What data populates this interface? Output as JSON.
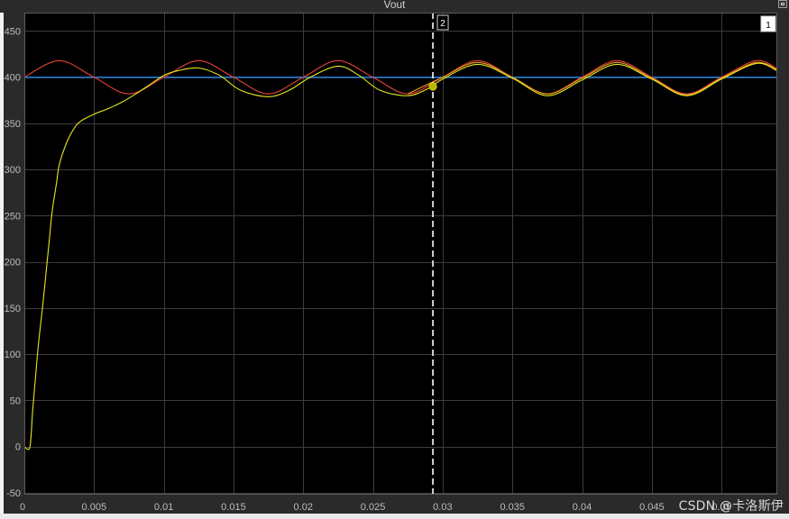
{
  "window": {
    "title": "Vout"
  },
  "watermark": "CSDN @卡洛斯伊",
  "cursors": [
    {
      "label": "1",
      "x": 0.05
    },
    {
      "label": "2",
      "x": 0.0293,
      "marker_y": 390
    }
  ],
  "colors": {
    "background": "#000000",
    "grid": "#3c3c3c",
    "axis_text": "#bdbdbd",
    "reference": "#1e90ff",
    "red": "#e8443a",
    "orange": "#f0a21e",
    "yellow": "#e6e61e",
    "cursor": "#ffffff",
    "marker": "#b8b800"
  },
  "chart_data": {
    "type": "line",
    "title": "Vout",
    "xlabel": "",
    "ylabel": "",
    "xlim": [
      0,
      0.054
    ],
    "ylim": [
      -52,
      470
    ],
    "grid": true,
    "x_ticks": [
      0,
      0.005,
      0.01,
      0.015,
      0.02,
      0.025,
      0.03,
      0.035,
      0.04,
      0.045,
      0.05
    ],
    "x_tick_labels": [
      "0",
      "0.005",
      "0.01",
      "0.015",
      "0.02",
      "0.025",
      "0.03",
      "0.035",
      "0.04",
      "0.045",
      "0.05"
    ],
    "y_ticks": [
      -50,
      0,
      50,
      100,
      150,
      200,
      250,
      300,
      350,
      400,
      450
    ],
    "y_tick_labels": [
      "-50",
      "0",
      "50",
      "100",
      "150",
      "200",
      "250",
      "300",
      "350",
      "400",
      "450"
    ],
    "series": [
      {
        "color": "#1e90ff",
        "x": [
          0,
          0.054
        ],
        "y": [
          400,
          400
        ]
      },
      {
        "color": "#e8443a",
        "x": [
          0,
          0.0025,
          0.005,
          0.0075,
          0.01,
          0.0125,
          0.015,
          0.0175,
          0.02,
          0.0225,
          0.025,
          0.0275,
          0.03,
          0.0325,
          0.035,
          0.0375,
          0.04,
          0.0425,
          0.045,
          0.0475,
          0.05,
          0.0525,
          0.054
        ],
        "y": [
          400,
          418,
          400,
          382,
          400,
          418,
          400,
          382,
          400,
          418,
          400,
          382,
          400,
          418,
          400,
          382,
          400,
          418,
          400,
          382,
          400,
          418,
          409
        ]
      },
      {
        "color": "#f0a21e",
        "x": [
          0.0275,
          0.03,
          0.0325,
          0.035,
          0.0375,
          0.04,
          0.0425,
          0.045,
          0.0475,
          0.05,
          0.0525,
          0.054
        ],
        "y": [
          382,
          400,
          416,
          400,
          382,
          399,
          416,
          399,
          381,
          399,
          416,
          408
        ]
      },
      {
        "color": "#e6e61e",
        "x": [
          0,
          0.0004,
          0.0006,
          0.0008,
          0.001,
          0.0013,
          0.0015,
          0.0018,
          0.002,
          0.0023,
          0.0025,
          0.003,
          0.0035,
          0.004,
          0.005,
          0.006,
          0.007,
          0.008,
          0.009,
          0.01,
          0.011,
          0.0125,
          0.014,
          0.0155,
          0.0175,
          0.019,
          0.0205,
          0.0225,
          0.024,
          0.0255,
          0.0275,
          0.029,
          0.03,
          0.0325,
          0.035,
          0.0375,
          0.04,
          0.0425,
          0.045,
          0.0475,
          0.05,
          0.0525,
          0.054
        ],
        "y": [
          0,
          0,
          40,
          75,
          110,
          150,
          180,
          225,
          255,
          285,
          305,
          328,
          343,
          352,
          360,
          366,
          373,
          382,
          392,
          402,
          407,
          410,
          402,
          386,
          379,
          386,
          400,
          412,
          402,
          386,
          380,
          388,
          398,
          414,
          399,
          380,
          397,
          414,
          398,
          380,
          398,
          415,
          407
        ]
      }
    ]
  }
}
